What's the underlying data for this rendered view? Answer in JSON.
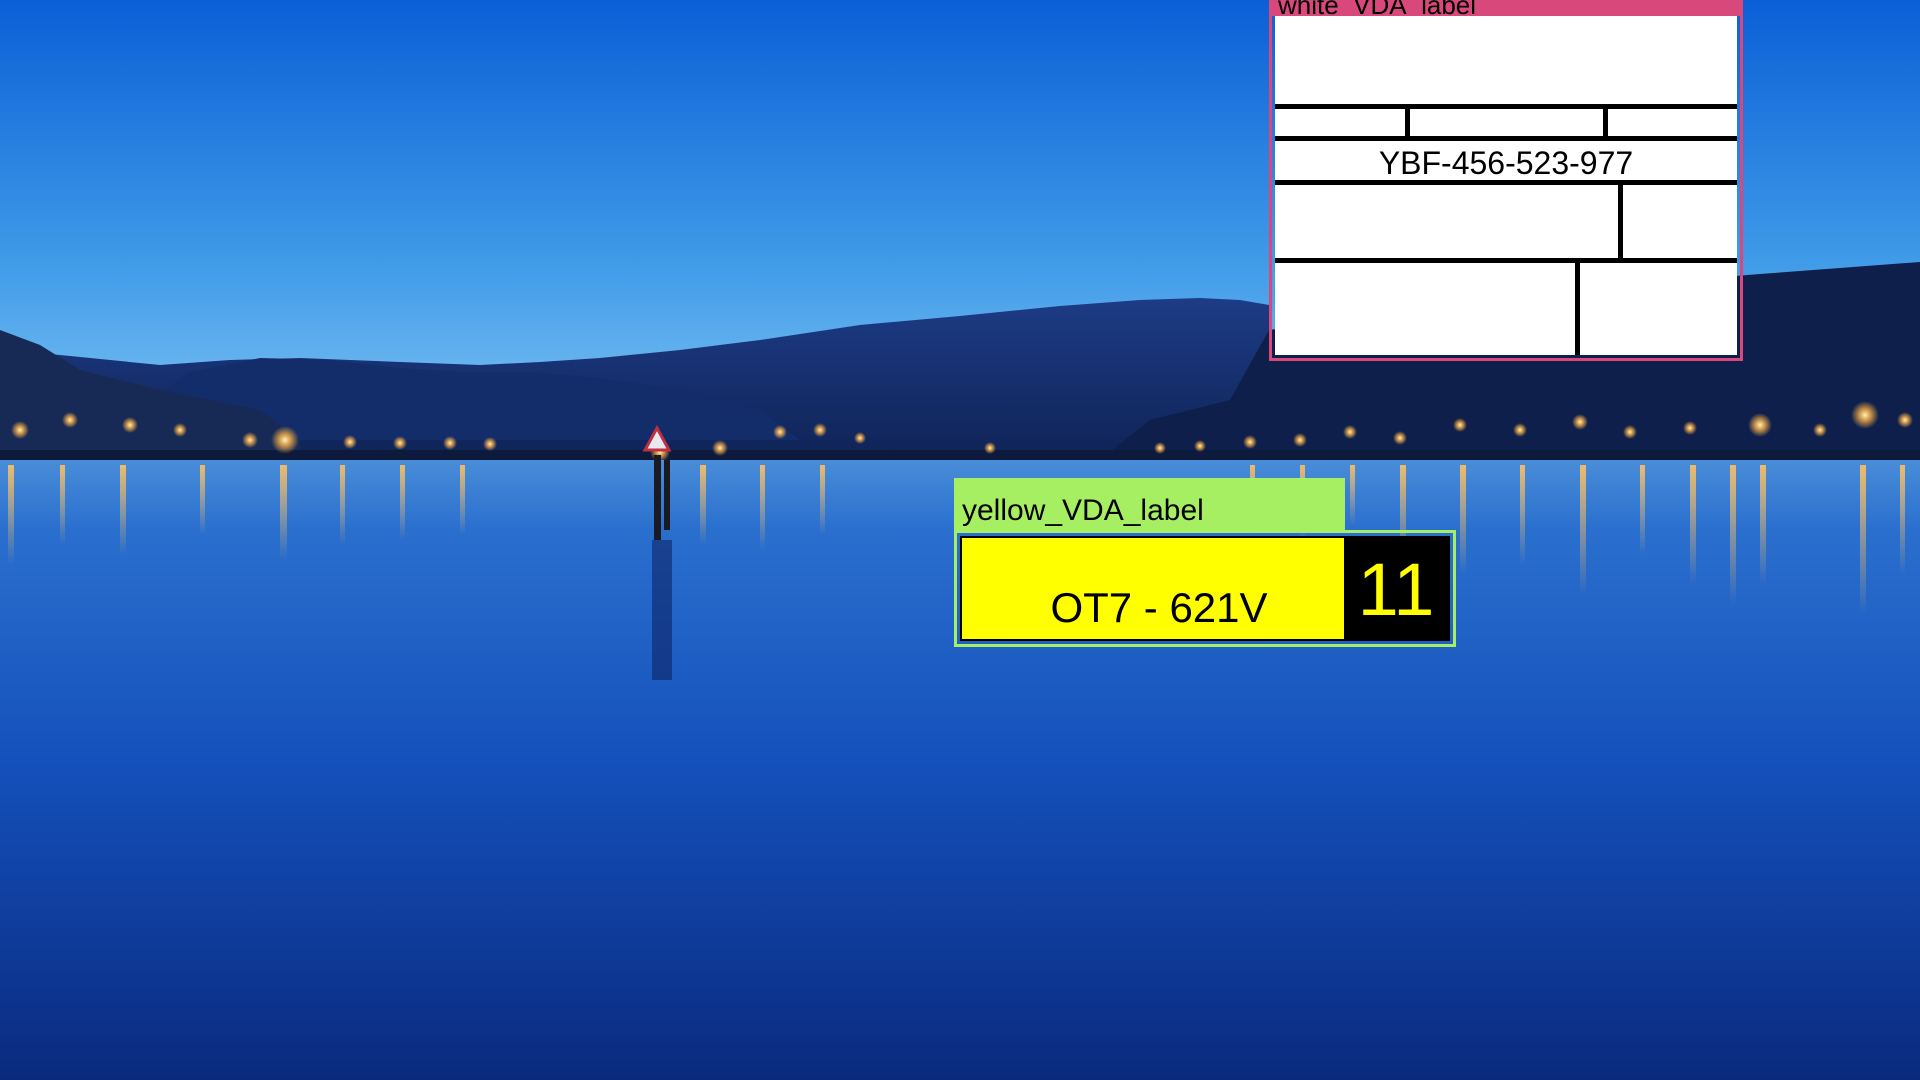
{
  "scene": {
    "subject": "night-lake-with-mountains-and-shore-lights",
    "sky_color_top": "#0a5fd6",
    "sky_color_horizon": "#7fc3f4",
    "water_color": "#0c3fa8",
    "light_color": "#ffb347"
  },
  "annotations": [
    {
      "class_tag": "white_VDA_label",
      "tag_color": "#d9487a",
      "label": {
        "code": "YBF-456-523-977",
        "background": "#ffffff"
      }
    },
    {
      "class_tag": "yellow_VDA_label",
      "tag_color": "#a6ee62",
      "label": {
        "code": "OT7 - 621V",
        "number": "11",
        "background": "#ffff00",
        "number_background": "#000000",
        "number_color": "#ffff00"
      }
    }
  ]
}
